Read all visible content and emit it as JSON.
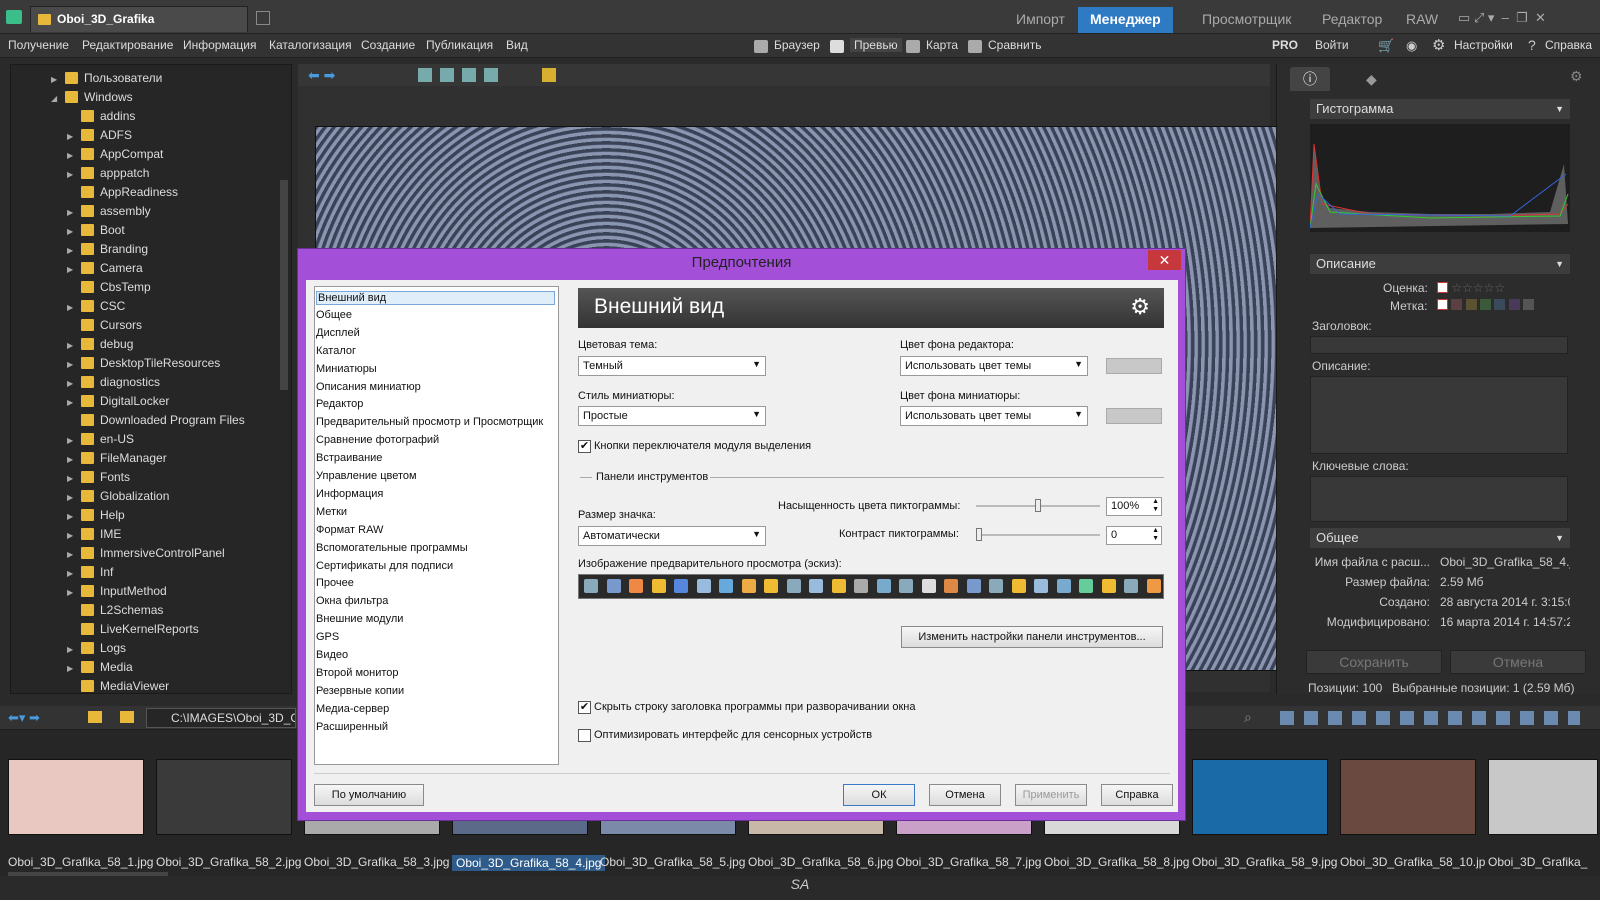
{
  "app": {
    "tab_title": "Oboi_3D_Grafika",
    "modes": [
      "Импорт",
      "Менеджер",
      "Просмотрщик",
      "Редактор",
      "RAW"
    ],
    "active_mode": "Менеджер"
  },
  "menu": {
    "items": [
      "Получение",
      "Редактирование",
      "Информация",
      "Каталогизация",
      "Создание",
      "Публикация",
      "Вид"
    ],
    "views": [
      "Браузер",
      "Превью",
      "Карта",
      "Сравнить"
    ],
    "right": [
      "PRO",
      "Войти",
      "Настройки",
      "Справка"
    ]
  },
  "tree": {
    "items": [
      {
        "label": "Пользователи",
        "level": 0,
        "arrow": "▶"
      },
      {
        "label": "Windows",
        "level": 0,
        "arrow": "◢"
      },
      {
        "label": "addins",
        "level": 1,
        "arrow": ""
      },
      {
        "label": "ADFS",
        "level": 1,
        "arrow": "▶"
      },
      {
        "label": "AppCompat",
        "level": 1,
        "arrow": "▶"
      },
      {
        "label": "apppatch",
        "level": 1,
        "arrow": "▶"
      },
      {
        "label": "AppReadiness",
        "level": 1,
        "arrow": ""
      },
      {
        "label": "assembly",
        "level": 1,
        "arrow": "▶"
      },
      {
        "label": "Boot",
        "level": 1,
        "arrow": "▶"
      },
      {
        "label": "Branding",
        "level": 1,
        "arrow": "▶"
      },
      {
        "label": "Camera",
        "level": 1,
        "arrow": "▶"
      },
      {
        "label": "CbsTemp",
        "level": 1,
        "arrow": ""
      },
      {
        "label": "CSC",
        "level": 1,
        "arrow": "▶"
      },
      {
        "label": "Cursors",
        "level": 1,
        "arrow": ""
      },
      {
        "label": "debug",
        "level": 1,
        "arrow": "▶"
      },
      {
        "label": "DesktopTileResources",
        "level": 1,
        "arrow": "▶"
      },
      {
        "label": "diagnostics",
        "level": 1,
        "arrow": "▶"
      },
      {
        "label": "DigitalLocker",
        "level": 1,
        "arrow": "▶"
      },
      {
        "label": "Downloaded Program Files",
        "level": 1,
        "arrow": ""
      },
      {
        "label": "en-US",
        "level": 1,
        "arrow": "▶"
      },
      {
        "label": "FileManager",
        "level": 1,
        "arrow": "▶"
      },
      {
        "label": "Fonts",
        "level": 1,
        "arrow": "▶"
      },
      {
        "label": "Globalization",
        "level": 1,
        "arrow": "▶"
      },
      {
        "label": "Help",
        "level": 1,
        "arrow": "▶"
      },
      {
        "label": "IME",
        "level": 1,
        "arrow": "▶"
      },
      {
        "label": "ImmersiveControlPanel",
        "level": 1,
        "arrow": "▶"
      },
      {
        "label": "Inf",
        "level": 1,
        "arrow": "▶"
      },
      {
        "label": "InputMethod",
        "level": 1,
        "arrow": "▶"
      },
      {
        "label": "L2Schemas",
        "level": 1,
        "arrow": ""
      },
      {
        "label": "LiveKernelReports",
        "level": 1,
        "arrow": ""
      },
      {
        "label": "Logs",
        "level": 1,
        "arrow": "▶"
      },
      {
        "label": "Media",
        "level": 1,
        "arrow": "▶"
      },
      {
        "label": "MediaViewer",
        "level": 1,
        "arrow": ""
      }
    ]
  },
  "right_panel": {
    "histogram": "Гистограмма",
    "description_head": "Описание",
    "rating_label": "Оценка:",
    "label_label": "Метка:",
    "caption_label": "Заголовок:",
    "desc_label": "Описание:",
    "keywords_label": "Ключевые слова:",
    "general_head": "Общее",
    "info": [
      {
        "k": "Имя файла с расш...",
        "v": "Oboi_3D_Grafika_58_4.jp"
      },
      {
        "k": "Размер файла:",
        "v": "2.59 Мб"
      },
      {
        "k": "Создано:",
        "v": "28 августа 2014 г. 3:15:0"
      },
      {
        "k": "Модифицировано:",
        "v": "16 марта 2014 г. 14:57:2"
      }
    ],
    "save": "Сохранить",
    "cancel": "Отмена",
    "positions": "Позиции: 100",
    "selected": "Выбранные позиции: 1 (2.59 Мб)"
  },
  "path": "C:\\IMAGES\\Oboi_3D_Gr",
  "thumbs": [
    {
      "name": "Oboi_3D_Grafika_58_1.jpg",
      "color": "#e8c8c0"
    },
    {
      "name": "Oboi_3D_Grafika_58_2.jpg",
      "color": "#3a3a3a"
    },
    {
      "name": "Oboi_3D_Grafika_58_3.jpg",
      "color": "#aaa"
    },
    {
      "name": "Oboi_3D_Grafika_58_4.jpg",
      "color": "#5a6a88"
    },
    {
      "name": "Oboi_3D_Grafika_58_5.jpg",
      "color": "#7a8aa8"
    },
    {
      "name": "Oboi_3D_Grafika_58_6.jpg",
      "color": "#c8b8a8"
    },
    {
      "name": "Oboi_3D_Grafika_58_7.jpg",
      "color": "#c8a0c8"
    },
    {
      "name": "Oboi_3D_Grafika_58_8.jpg",
      "color": "#d8d8d8"
    },
    {
      "name": "Oboi_3D_Grafika_58_9.jpg",
      "color": "#1a6aa8"
    },
    {
      "name": "Oboi_3D_Grafika_58_10.jpg",
      "color": "#6a4a40"
    },
    {
      "name": "Oboi_3D_Grafika_",
      "color": "#c8c8c8"
    }
  ],
  "selected_thumb": 3,
  "dialog": {
    "title": "Предпочтения",
    "close": "✕",
    "list": [
      "Внешний вид",
      "Общее",
      "Дисплей",
      "Каталог",
      "Миниатюры",
      "Описания миниатюр",
      "Редактор",
      "Предварительный просмотр и Просмотрщик",
      "Сравнение фотографий",
      "Встраивание",
      "Управление цветом",
      "Информация",
      "Метки",
      "Формат RAW",
      "Вспомогательные программы",
      "Сертификаты для подписи",
      "Прочее",
      "Окна фильтра",
      "Внешние модули",
      "GPS",
      "Видео",
      "Второй монитор",
      "Резервные копии",
      "Медиа-сервер",
      "Расширенный"
    ],
    "selected_index": 0,
    "heading": "Внешний вид",
    "color_theme_label": "Цветовая тема:",
    "color_theme_value": "Темный",
    "editor_bg_label": "Цвет фона редактора:",
    "editor_bg_value": "Использовать цвет темы",
    "thumb_style_label": "Стиль миниатюры:",
    "thumb_style_value": "Простые",
    "thumb_bg_label": "Цвет фона миниатюры:",
    "thumb_bg_value": "Использовать цвет темы",
    "module_buttons": "Кнопки переключателя модуля выделения",
    "module_buttons_checked": true,
    "toolbars_group": "Панели инструментов",
    "saturation_label": "Насыщенность цвета пиктограммы:",
    "saturation_value": "100%",
    "saturation_level": 0.5,
    "icon_size_label": "Размер значка:",
    "icon_size_value": "Автоматически",
    "contrast_label": "Контраст пиктограммы:",
    "contrast_value": "0",
    "contrast_level": 0.0,
    "preview_label": "Изображение предварительного просмотра (эскиз):",
    "toolbar_settings": "Изменить настройки панели инструментов...",
    "hide_title": "Скрыть строку заголовка программы при разворачивании окна",
    "hide_title_checked": true,
    "touch": "Оптимизировать интерфейс для сенсорных устройств",
    "touch_checked": false,
    "default_btn": "По умолчанию",
    "ok": "ОК",
    "cancel": "Отмена",
    "apply": "Применить",
    "help": "Справка"
  },
  "status_mark": "SA",
  "colors": {
    "accent": "#2e7bc4",
    "dialog_border": "#a34fd8",
    "folder": "#e8b83a"
  }
}
